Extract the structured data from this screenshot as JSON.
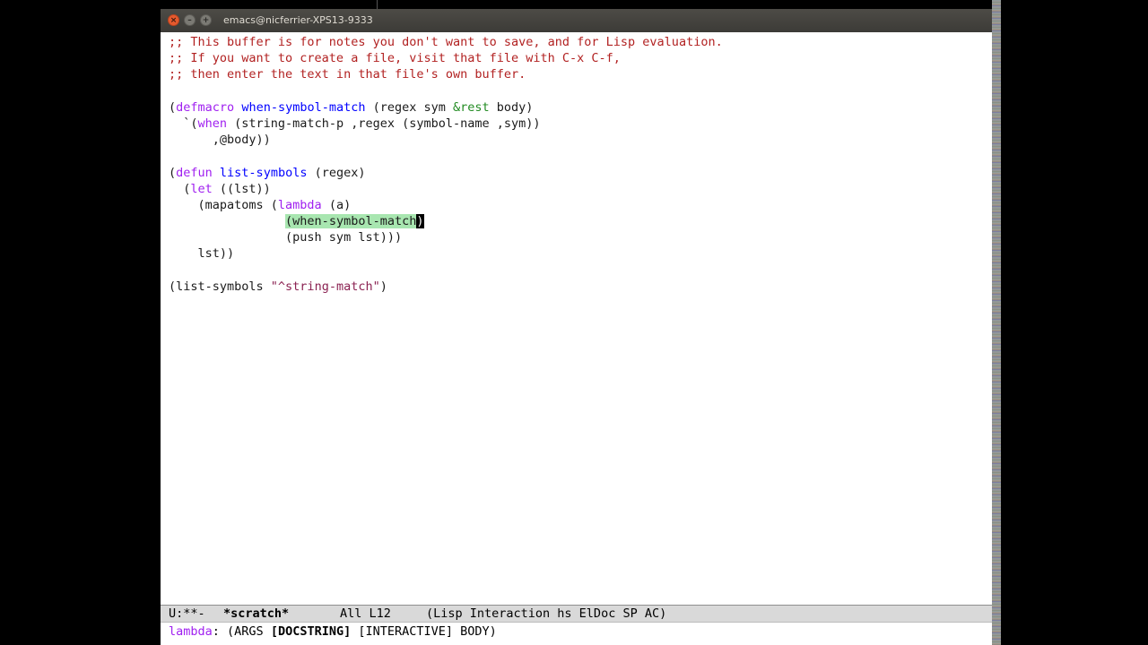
{
  "window": {
    "title": "emacs@nicferrier-XPS13-9333",
    "close_glyph": "×",
    "min_glyph": "–",
    "max_glyph": "+"
  },
  "buffer": {
    "comment1": ";; This buffer is for notes you don't want to save, and for Lisp evaluation.",
    "comment2": ";; If you want to create a file, visit that file with C-x C-f,",
    "comment3": ";; then enter the text in that file's own buffer.",
    "l5_open": "(",
    "l5_kw": "defmacro",
    "l5_sp": " ",
    "l5_name": "when-symbol-match",
    "l5_args1": " (regex sym ",
    "l5_rest": "&rest",
    "l5_args2": " body)",
    "l6_a": "  `(",
    "l6_kw": "when",
    "l6_b": " (string-match-p ,regex (symbol-name ,sym))",
    "l7": "      ,@body))",
    "l9_open": "(",
    "l9_kw": "defun",
    "l9_sp": " ",
    "l9_name": "list-symbols",
    "l9_args": " (regex)",
    "l10_a": "  (",
    "l10_kw": "let",
    "l10_b": " ((lst))",
    "l11_a": "    (mapatoms (",
    "l11_kw": "lambda",
    "l11_b": " (a)",
    "l12_indent": "                ",
    "l12_hl": "(when-symbol-match",
    "l12_cursor": ")",
    "l13": "                (push sym lst)))",
    "l14": "    lst))",
    "l16_a": "(list-symbols ",
    "l16_str": "\"^string-match\"",
    "l16_b": ")"
  },
  "modeline": {
    "status": "U:**-",
    "buffer_name": "*scratch*",
    "position": "All L12",
    "modes": "(Lisp Interaction hs ElDoc SP AC)"
  },
  "echo": {
    "fn": "lambda",
    "pre": ": (ARGS ",
    "current_arg": "[DOCSTRING]",
    "post": " [INTERACTIVE] BODY)"
  },
  "colors": {
    "comment": "#b22222",
    "keyword": "#a020f0",
    "function_name": "#0000ff",
    "string": "#8b2252",
    "type": "#228b22",
    "highlight": "#a8e6b0"
  }
}
